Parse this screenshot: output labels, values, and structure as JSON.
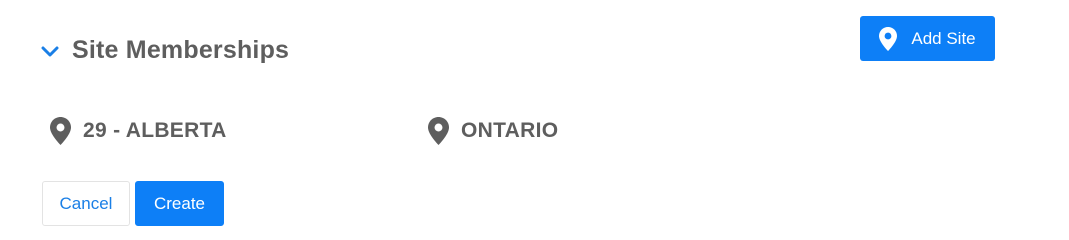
{
  "section": {
    "title": "Site Memberships",
    "expanded": true
  },
  "toolbar": {
    "add_site_label": "Add Site"
  },
  "sites": [
    {
      "label": "29 - ALBERTA",
      "icon": "map-pin-icon"
    },
    {
      "label": "ONTARIO",
      "icon": "map-pin-icon"
    }
  ],
  "actions": {
    "cancel_label": "Cancel",
    "create_label": "Create"
  },
  "colors": {
    "primary": "#0d7ff7",
    "text": "#5e5e5e",
    "link": "#1a7fe6"
  }
}
